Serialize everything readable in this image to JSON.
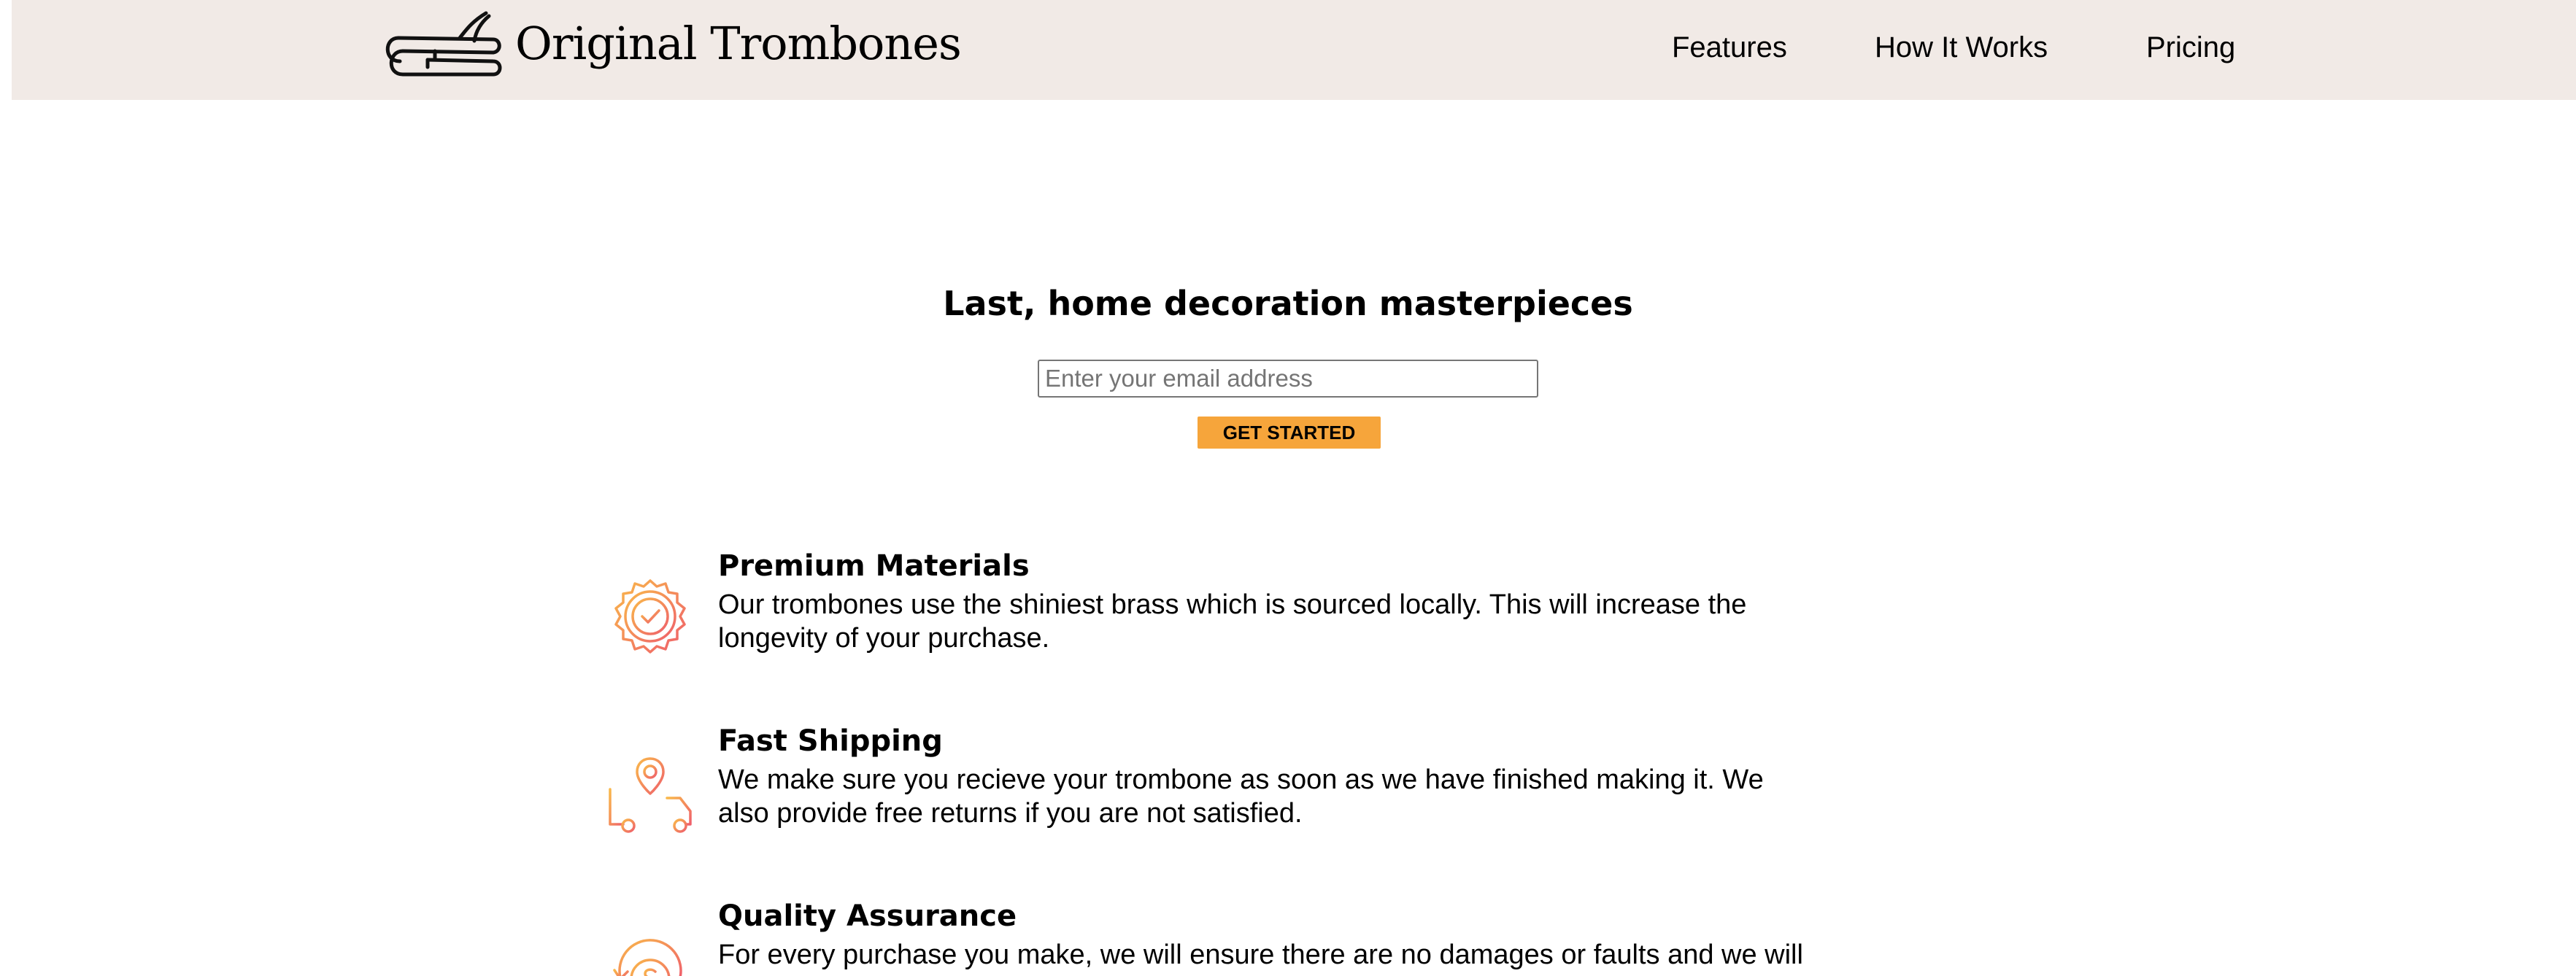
{
  "header": {
    "brand": "Original Trombones",
    "logo_icon": "trombone-icon",
    "nav": [
      {
        "label": "Features"
      },
      {
        "label": "How It Works"
      },
      {
        "label": "Pricing"
      }
    ]
  },
  "hero": {
    "title": "Last, home decoration masterpieces",
    "email_placeholder": "Enter your email address",
    "cta_label": "GET STARTED"
  },
  "features": [
    {
      "icon": "quality-badge-icon",
      "title": "Premium Materials",
      "description": "Our trombones use the shiniest brass which is sourced locally. This will increase the longevity of your purchase."
    },
    {
      "icon": "delivery-truck-icon",
      "title": "Fast Shipping",
      "description": "We make sure you recieve your trombone as soon as we have finished making it. We also provide free returns if you are not satisfied."
    },
    {
      "icon": "money-back-icon",
      "title": "Quality Assurance",
      "description": "For every purchase you make, we will ensure there are no damages or faults and we will check and test"
    }
  ],
  "colors": {
    "header_bg": "#f1eae6",
    "accent": "#f6a53b",
    "icon_gradient_start": "#f9b84a",
    "icon_gradient_end": "#ef5f6b"
  }
}
